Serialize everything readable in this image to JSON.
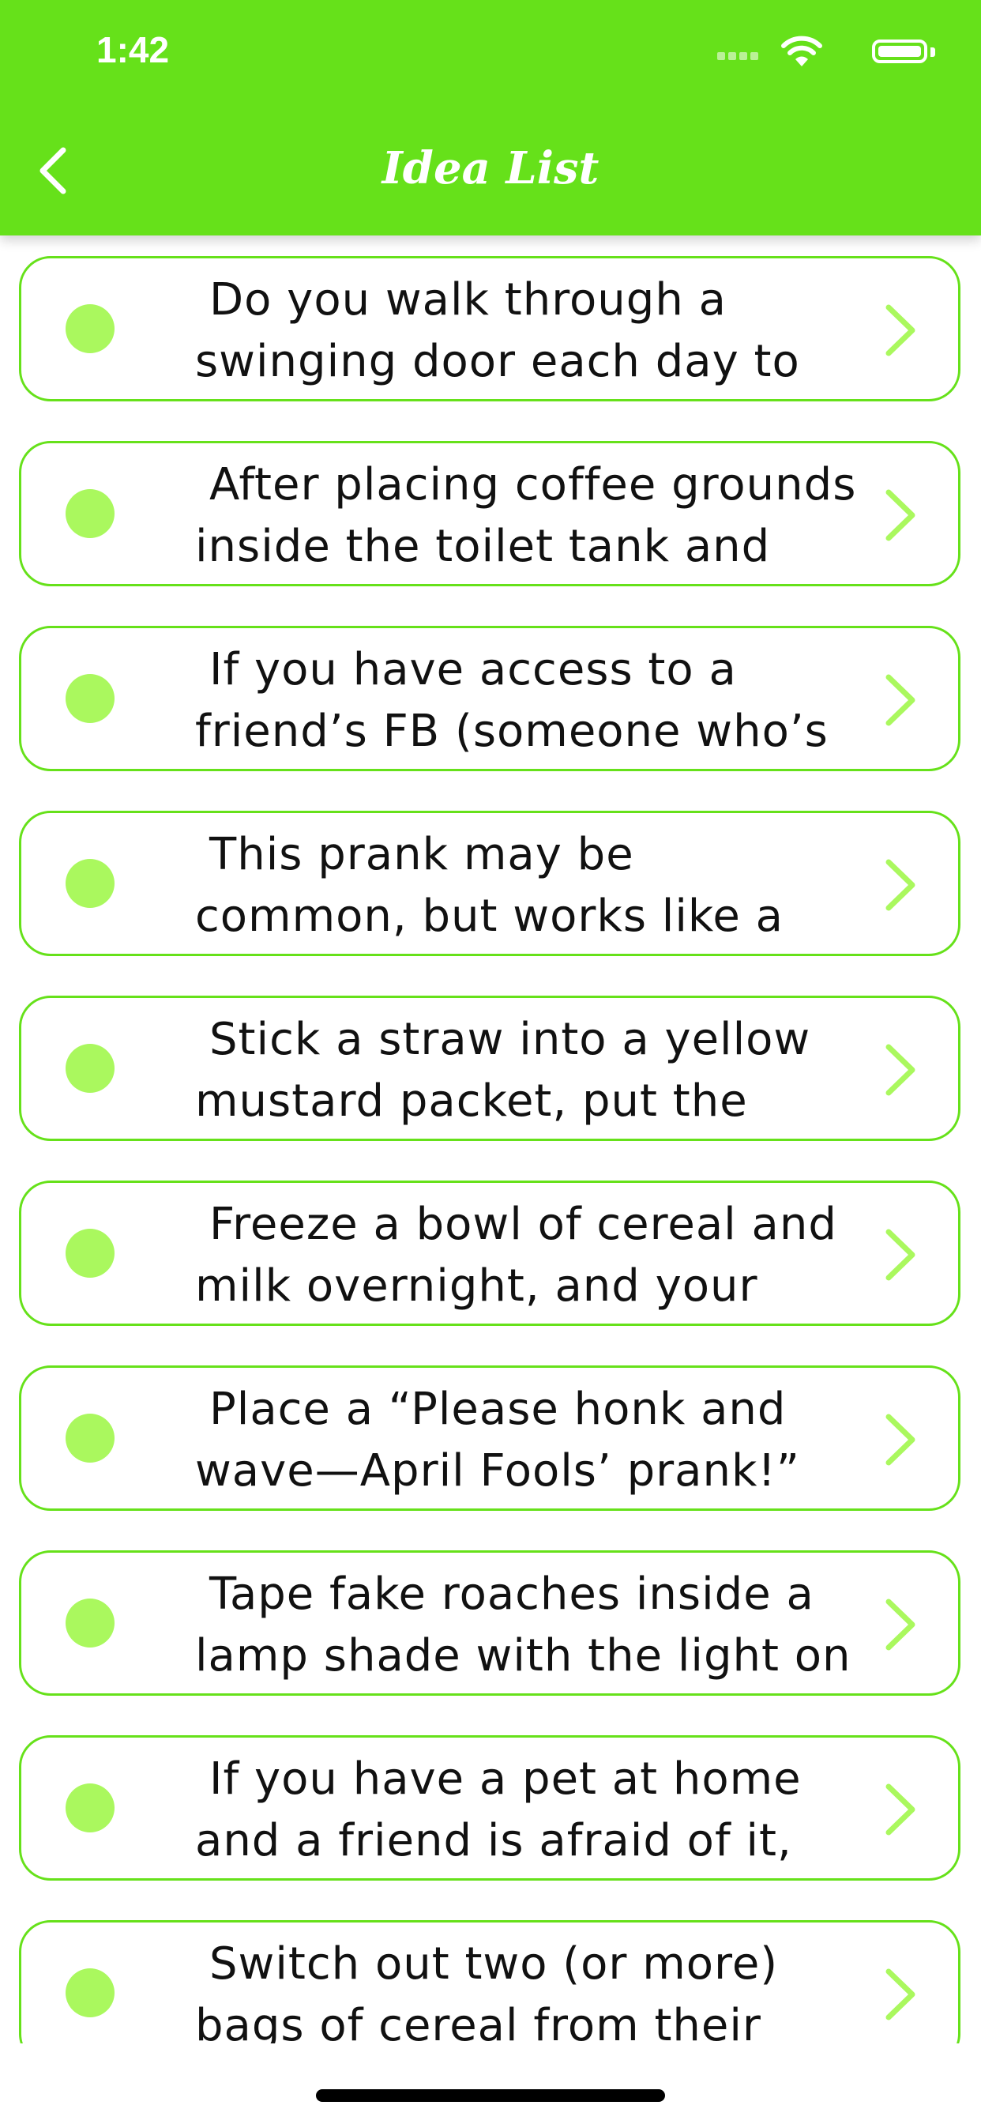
{
  "status_bar": {
    "time": "1:42"
  },
  "header": {
    "title": "Idea List"
  },
  "colors": {
    "header_green": "#66e11a",
    "card_border": "#66e11a",
    "dot": "#aaf85e",
    "chevron": "#aaf85e"
  },
  "icons": {
    "back": "chevron-left-icon",
    "row_marker": "dot-icon",
    "row_disclosure": "chevron-right-icon"
  },
  "ideas": [
    {
      "text": "Do you walk through a swinging door each day to"
    },
    {
      "text": "After placing coffee grounds inside the toilet tank and"
    },
    {
      "text": "If you have access to a friend’s FB (someone who’s a"
    },
    {
      "text": "This prank may be common, but works like a charm every"
    },
    {
      "text": "Stick a straw into a yellow mustard packet, put the"
    },
    {
      "text": "Freeze a bowl of cereal and milk overnight, and your"
    },
    {
      "text": "Place a “Please honk and wave—April Fools’ prank!”"
    },
    {
      "text": "Tape fake roaches inside a lamp shade with the light on"
    },
    {
      "text": "If you have a pet at home and a friend is afraid of it,"
    },
    {
      "text": "Switch out two (or more) bags of cereal from their"
    }
  ]
}
